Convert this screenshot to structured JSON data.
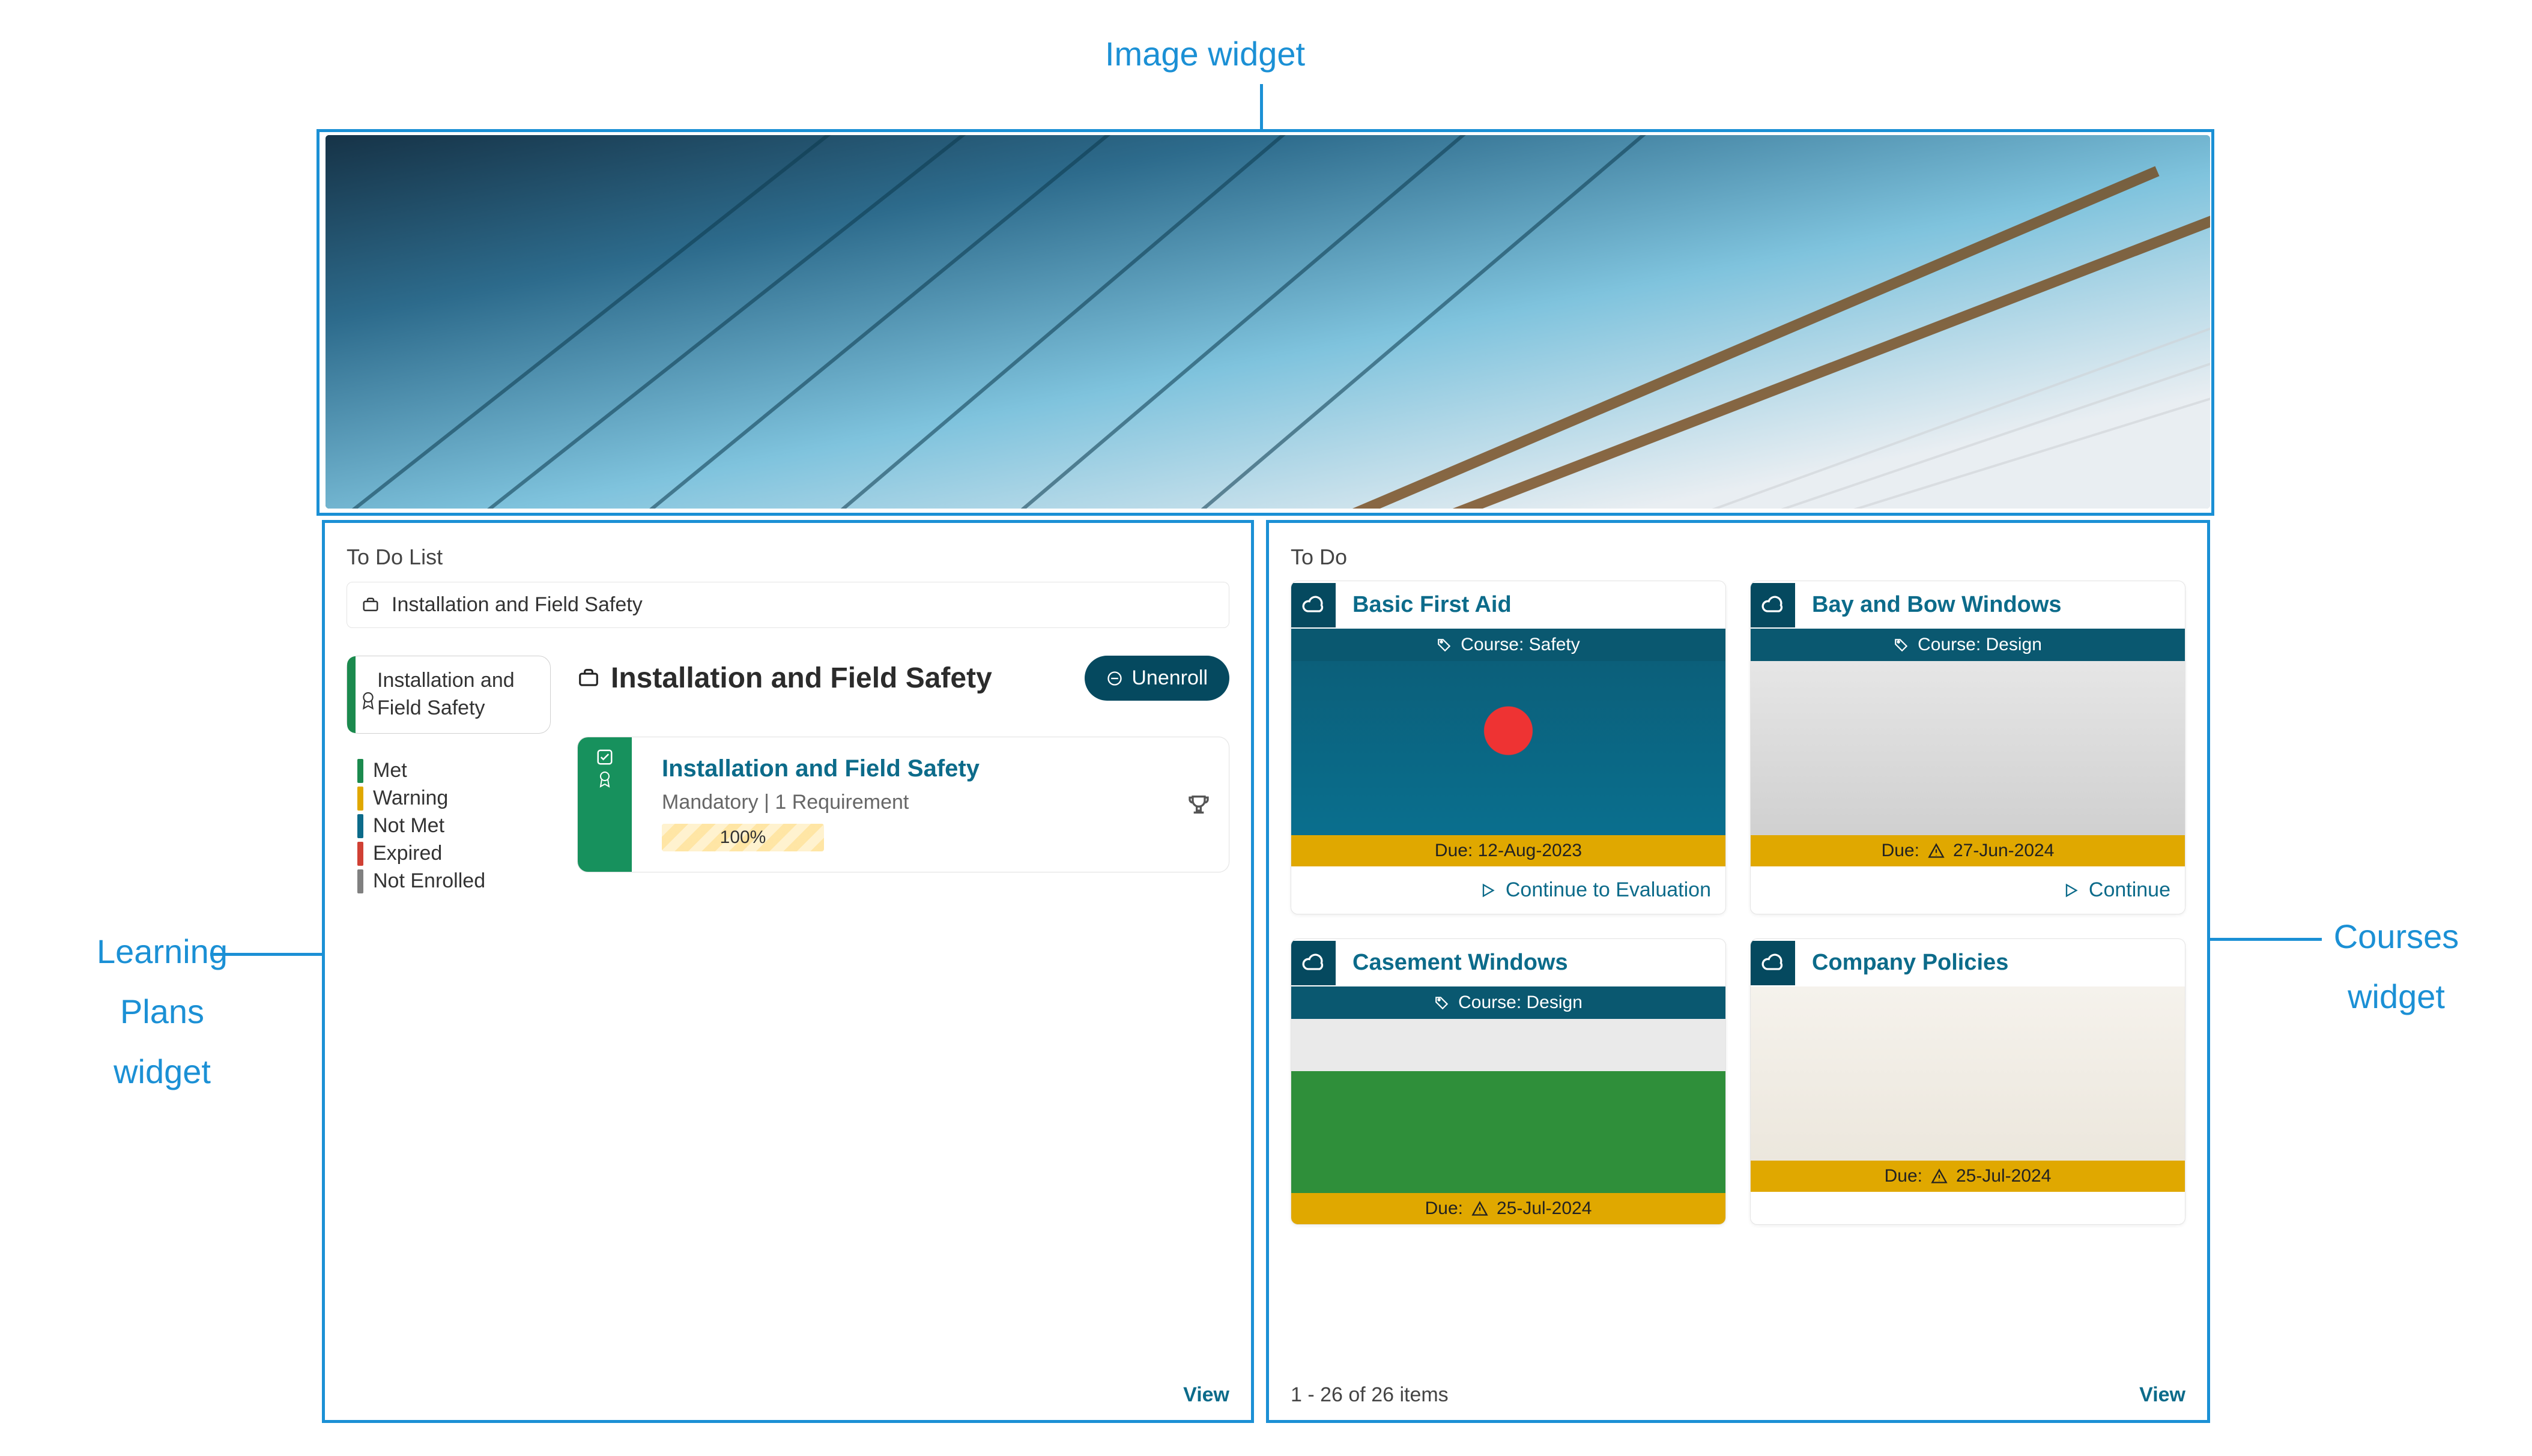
{
  "annotations": {
    "image_widget": "Image widget",
    "lp_widget_l1": "Learning",
    "lp_widget_l2": "Plans",
    "lp_widget_l3": "widget",
    "courses_l1": "Courses",
    "courses_l2": "widget"
  },
  "lp": {
    "section_title": "To Do List",
    "tree_label": "Installation and Field Safety",
    "side": {
      "plan_title": "Installation and Field Safety"
    },
    "legend": [
      {
        "label": "Met",
        "color": "#1b8a4e"
      },
      {
        "label": "Warning",
        "color": "#e0a800"
      },
      {
        "label": "Not Met",
        "color": "#0c6b8a"
      },
      {
        "label": "Expired",
        "color": "#d04034"
      },
      {
        "label": "Not Enrolled",
        "color": "#808080"
      }
    ],
    "main": {
      "title": "Installation and Field Safety",
      "unenroll": "Unenroll",
      "req": {
        "title": "Installation and Field Safety",
        "meta": "Mandatory | 1 Requirement",
        "progress_label": "100%"
      }
    },
    "footer_view": "View"
  },
  "courses": {
    "section_title": "To Do",
    "pagination": "1 - 26 of 26 items",
    "footer_view": "View",
    "cards": [
      {
        "title": "Basic First Aid",
        "banner": "Course: Safety",
        "due": "Due: 12-Aug-2023",
        "warn": false,
        "action": "Continue to Evaluation",
        "thumb": "thumb-firstaid"
      },
      {
        "title": "Bay and Bow Windows",
        "banner": "Course: Design",
        "due": "Due:",
        "due_date": "27-Jun-2024",
        "warn": true,
        "action": "Continue",
        "thumb": "thumb-bay"
      },
      {
        "title": "Casement Windows",
        "banner": "Course: Design",
        "due": "Due:",
        "due_date": "25-Jul-2024",
        "warn": true,
        "action": "",
        "thumb": "thumb-casement"
      },
      {
        "title": "Company Policies",
        "banner": "",
        "due": "Due:",
        "due_date": "25-Jul-2024",
        "warn": true,
        "action": "",
        "thumb": "thumb-policies"
      }
    ]
  },
  "icons": {
    "briefcase": "briefcase-icon",
    "ribbon": "ribbon-icon",
    "cloud": "cloud-icon",
    "tag": "tag-icon",
    "warn": "warning-icon",
    "play": "play-icon",
    "trophy": "trophy-icon",
    "minus": "minus-circle-icon",
    "check": "checklist-icon"
  }
}
